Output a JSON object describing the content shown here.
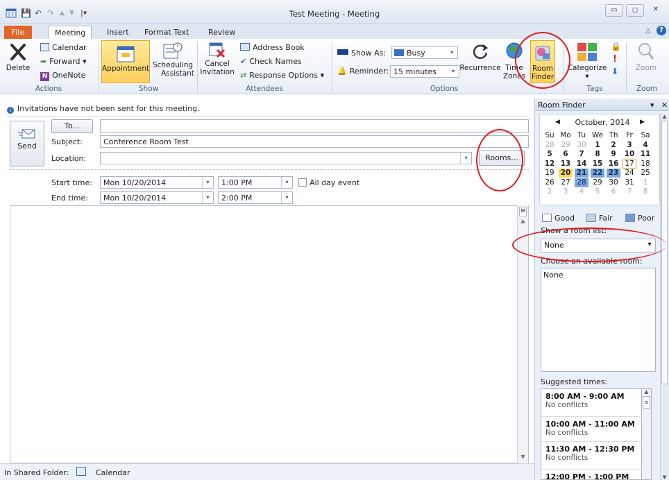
{
  "window": {
    "title": "Test Meeting - Meeting",
    "buttons": {
      "minimize": "▭",
      "maximize": "◻",
      "close": "✕"
    }
  },
  "quick_access": {
    "save": "💾",
    "undo": "↶",
    "redo": "↷",
    "up": "▲",
    "down": "▼",
    "customize": "|▾"
  },
  "tabs": [
    {
      "label": "File"
    },
    {
      "label": "Meeting"
    },
    {
      "label": "Insert"
    },
    {
      "label": "Format Text"
    },
    {
      "label": "Review"
    }
  ],
  "ribbon": {
    "actions": {
      "group_label": "Actions",
      "delete": "Delete",
      "calendar": "Calendar",
      "forward": "Forward ▾",
      "onenote": "OneNote"
    },
    "show": {
      "group_label": "Show",
      "appointment": "Appointment",
      "scheduling_1": "Scheduling",
      "scheduling_2": "Assistant"
    },
    "attendees": {
      "group_label": "Attendees",
      "cancel_1": "Cancel",
      "cancel_2": "Invitation",
      "address_book": "Address Book",
      "check_names": "Check Names",
      "response_options": "Response Options ▾"
    },
    "options": {
      "group_label": "Options",
      "show_as_label": "Show As:",
      "show_as_value": "Busy",
      "reminder_label": "Reminder:",
      "reminder_value": "15 minutes",
      "recurrence": "Recurrence",
      "time_zones_1": "Time",
      "time_zones_2": "Zones",
      "room_finder_1": "Room",
      "room_finder_2": "Finder"
    },
    "tags": {
      "group_label": "Tags",
      "categorize": "Categorize",
      "categorize_arrow": "▾"
    },
    "zoom": {
      "group_label": "Zoom",
      "zoom": "Zoom"
    }
  },
  "infobar": {
    "icon": "i",
    "text": "Invitations have not been sent for this meeting."
  },
  "form": {
    "send": "Send",
    "to_button": "To...",
    "to_value": "",
    "subject_label": "Subject:",
    "subject_value": "Conference Room Test",
    "location_label": "Location:",
    "location_value": "",
    "rooms_button": "Rooms...",
    "start_label": "Start time:",
    "start_date": "Mon 10/20/2014",
    "start_time": "1:00 PM",
    "all_day": "All day event",
    "end_label": "End time:",
    "end_date": "Mon 10/20/2014",
    "end_time": "2:00 PM",
    "body_text": ""
  },
  "status": {
    "folder_label": "In Shared Folder:",
    "folder_name": "Calendar"
  },
  "room_finder": {
    "title": "Room Finder",
    "header_controls": {
      "dropdown": "▾",
      "close": "✕"
    },
    "month_label": "October, 2014",
    "prev": "◀",
    "next": "▶",
    "weekdays": [
      "Su",
      "Mo",
      "Tu",
      "We",
      "Th",
      "Fr",
      "Sa"
    ],
    "weeks": [
      [
        "28",
        "29",
        "30",
        "1",
        "2",
        "3",
        "4"
      ],
      [
        "5",
        "6",
        "7",
        "8",
        "9",
        "10",
        "11"
      ],
      [
        "12",
        "13",
        "14",
        "15",
        "16",
        "17",
        "18"
      ],
      [
        "19",
        "20",
        "21",
        "22",
        "23",
        "24",
        "25"
      ],
      [
        "26",
        "27",
        "28",
        "29",
        "30",
        "31",
        "1"
      ],
      [
        "2",
        "3",
        "4",
        "5",
        "6",
        "7",
        "8"
      ]
    ],
    "legend": {
      "good": "Good",
      "fair": "Fair",
      "poor": "Poor"
    },
    "room_list_label": "Show a room list:",
    "room_list_value": "None",
    "available_label": "Choose an available room:",
    "available_rooms": [
      "None"
    ],
    "suggested_label": "Suggested times:",
    "suggested": [
      {
        "time": "8:00 AM - 9:00 AM",
        "status": "No conflicts"
      },
      {
        "time": "10:00 AM - 11:00 AM",
        "status": "No conflicts"
      },
      {
        "time": "11:30 AM - 12:30 PM",
        "status": "No conflicts"
      },
      {
        "time": "12:00 PM - 1:00 PM",
        "status": ""
      }
    ]
  },
  "colors": {
    "file_tab": "#e0662a",
    "highlight": "#ffcf5c",
    "selected_day": "#7fa6d8",
    "annotation_circle": "#e41a1a"
  }
}
